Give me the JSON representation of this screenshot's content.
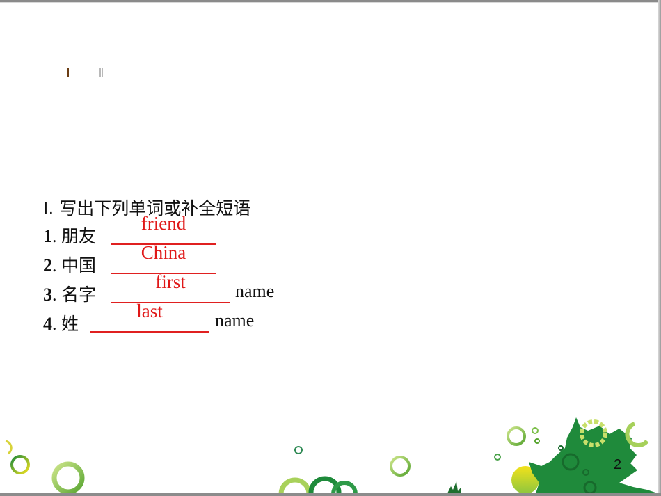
{
  "slide": {
    "tab_marks": [
      "I",
      "II"
    ],
    "heading": {
      "roman": "Ⅰ",
      "text": ". 写出下列单词或补全短语"
    },
    "items": [
      {
        "number": "1",
        "prompt": "朋友",
        "answer": "friend",
        "suffix": ""
      },
      {
        "number": "2",
        "prompt": "中国",
        "answer": "China",
        "suffix": ""
      },
      {
        "number": "3",
        "prompt": "名字",
        "answer": "first",
        "suffix": "name"
      },
      {
        "number": "4",
        "prompt": "姓",
        "answer": "last",
        "suffix": "name"
      }
    ],
    "page_number": "2",
    "colors": {
      "answer_red": "#e01818",
      "leaf_green": "#1e8a3a",
      "ring_light_green": "#8cc63f",
      "ring_yellow": "#e6d21e"
    }
  }
}
